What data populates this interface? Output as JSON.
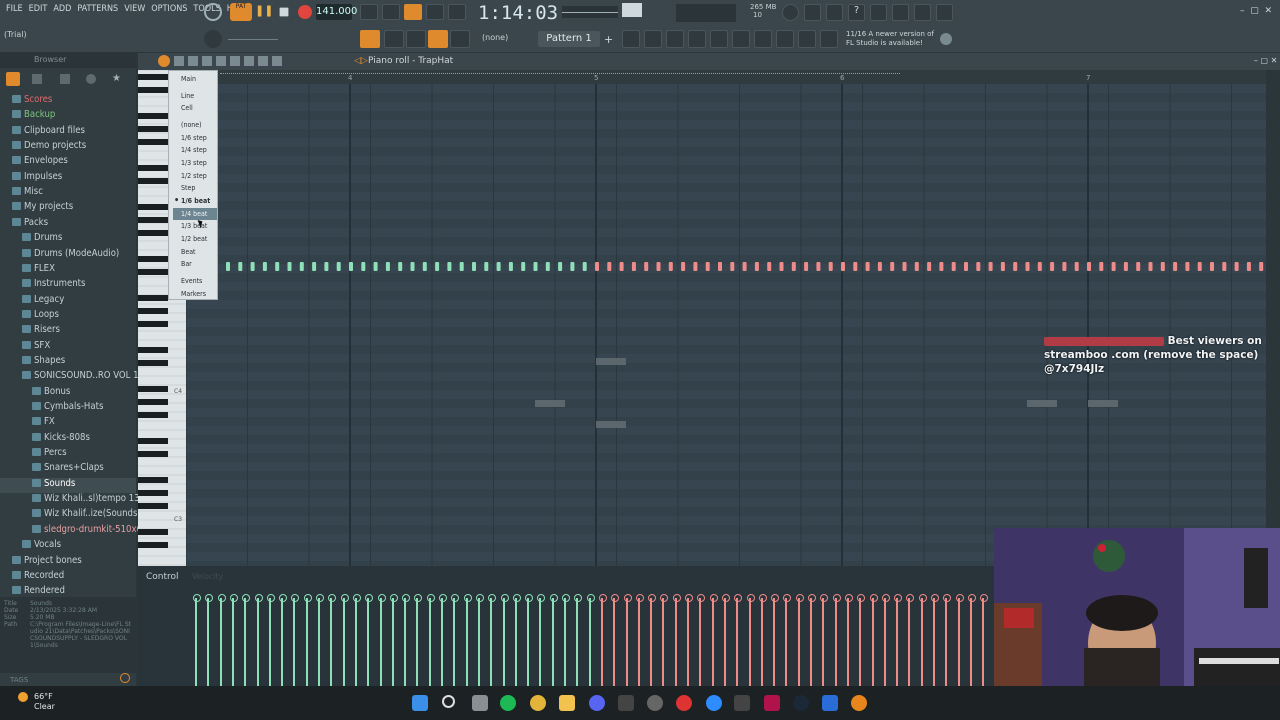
{
  "menu": [
    "FILE",
    "EDIT",
    "ADD",
    "PATTERNS",
    "VIEW",
    "OPTIONS",
    "TOOLS",
    "HELP"
  ],
  "toolbar": {
    "pat_label": "PAT",
    "tempo": "141.000",
    "time": "1:14:03",
    "mem_top": "265 MB",
    "mem_bot": "10",
    "trial": "(Trial)",
    "snap_value": "(none)",
    "pattern": "Pattern 1",
    "notice_num": "11/16",
    "notice": "A newer version of FL Studio is available!"
  },
  "browser": {
    "header": "Browser",
    "items": [
      {
        "label": "Scores",
        "indent": 0,
        "color": "#e06a6a"
      },
      {
        "label": "Backup",
        "indent": 0,
        "color": "#7bc77b"
      },
      {
        "label": "Clipboard files",
        "indent": 0,
        "color": "#c3d1d6"
      },
      {
        "label": "Demo projects",
        "indent": 0,
        "color": "#c3d1d6"
      },
      {
        "label": "Envelopes",
        "indent": 0,
        "color": "#c3d1d6"
      },
      {
        "label": "Impulses",
        "indent": 0,
        "color": "#c3d1d6"
      },
      {
        "label": "Misc",
        "indent": 0,
        "color": "#c3d1d6"
      },
      {
        "label": "My projects",
        "indent": 0,
        "color": "#c3d1d6"
      },
      {
        "label": "Packs",
        "indent": 0,
        "color": "#c3d1d6"
      },
      {
        "label": "Drums",
        "indent": 1,
        "color": "#c3d1d6"
      },
      {
        "label": "Drums (ModeAudio)",
        "indent": 1,
        "color": "#c3d1d6"
      },
      {
        "label": "FLEX",
        "indent": 1,
        "color": "#c3d1d6"
      },
      {
        "label": "Instruments",
        "indent": 1,
        "color": "#c3d1d6"
      },
      {
        "label": "Legacy",
        "indent": 1,
        "color": "#c3d1d6"
      },
      {
        "label": "Loops",
        "indent": 1,
        "color": "#c3d1d6"
      },
      {
        "label": "Risers",
        "indent": 1,
        "color": "#c3d1d6"
      },
      {
        "label": "SFX",
        "indent": 1,
        "color": "#c3d1d6"
      },
      {
        "label": "Shapes",
        "indent": 1,
        "color": "#c3d1d6"
      },
      {
        "label": "SONICSOUND..RO VOL 1",
        "indent": 1,
        "color": "#c3d1d6"
      },
      {
        "label": "Bonus",
        "indent": 2,
        "color": "#c3d1d6"
      },
      {
        "label": "Cymbals-Hats",
        "indent": 2,
        "color": "#c3d1d6"
      },
      {
        "label": "FX",
        "indent": 2,
        "color": "#c3d1d6"
      },
      {
        "label": "Kicks-808s",
        "indent": 2,
        "color": "#c3d1d6"
      },
      {
        "label": "Percs",
        "indent": 2,
        "color": "#c3d1d6"
      },
      {
        "label": "Snares+Claps",
        "indent": 2,
        "color": "#c3d1d6"
      },
      {
        "label": "Sounds",
        "indent": 2,
        "color": "#ffffff"
      },
      {
        "label": "Wiz Khali..sl)tempo 134",
        "indent": 2,
        "color": "#c3d1d6"
      },
      {
        "label": "Wiz Khalif..ize(Sounds)",
        "indent": 2,
        "color": "#c3d1d6"
      },
      {
        "label": "sledgro-drumkit-510x652",
        "indent": 2,
        "color": "#e6a0a0"
      },
      {
        "label": "Vocals",
        "indent": 1,
        "color": "#c3d1d6"
      },
      {
        "label": "Project bones",
        "indent": 0,
        "color": "#c3d1d6"
      },
      {
        "label": "Recorded",
        "indent": 0,
        "color": "#c3d1d6"
      },
      {
        "label": "Rendered",
        "indent": 0,
        "color": "#c3d1d6"
      }
    ],
    "info": [
      {
        "k": "Title",
        "v": "Sounds"
      },
      {
        "k": "Date",
        "v": "2/13/2025 3:32:28 AM"
      },
      {
        "k": "Size",
        "v": "5.20 MB"
      },
      {
        "k": "Path",
        "v": "C:\\Program Files\\Image-Line\\FL Studio 21\\Data\\Patches\\Packs\\SONICSOUNDSUPPLY - SLEDGRO VOL 1\\Sounds"
      }
    ],
    "tags_label": "TAGS"
  },
  "piano_roll": {
    "title": "Piano roll - TrapHat",
    "bar_numbers": [
      "4",
      "5",
      "6",
      "7"
    ],
    "key_labels": {
      "c4": "C4",
      "c3": "C3"
    },
    "control_label": "Control",
    "control_sub": "Velocity",
    "colors": {
      "green": "#8fe0b8",
      "red": "#ef8b88"
    }
  },
  "snap_menu": {
    "items": [
      {
        "label": "Main",
        "state": "normal"
      },
      {
        "label": "Line",
        "state": "normal"
      },
      {
        "label": "Cell",
        "state": "normal"
      },
      {
        "label": "(none)",
        "state": "normal"
      },
      {
        "label": "1/6 step",
        "state": "normal"
      },
      {
        "label": "1/4 step",
        "state": "normal"
      },
      {
        "label": "1/3 step",
        "state": "normal"
      },
      {
        "label": "1/2 step",
        "state": "normal"
      },
      {
        "label": "Step",
        "state": "normal"
      },
      {
        "label": "1/6 beat",
        "state": "checked"
      },
      {
        "label": "1/4 beat",
        "state": "highlighted"
      },
      {
        "label": "1/3 beat",
        "state": "normal"
      },
      {
        "label": "1/2 beat",
        "state": "normal"
      },
      {
        "label": "Beat",
        "state": "normal"
      },
      {
        "label": "Bar",
        "state": "normal"
      },
      {
        "label": "Events",
        "state": "normal"
      },
      {
        "label": "Markers",
        "state": "normal"
      }
    ]
  },
  "overlay": {
    "line1": "Best viewers on",
    "line2": "streamboo .com (remove the space)",
    "line3": "@7x794Jlz"
  },
  "taskbar": {
    "temp": "66°F",
    "weather": "Clear"
  }
}
